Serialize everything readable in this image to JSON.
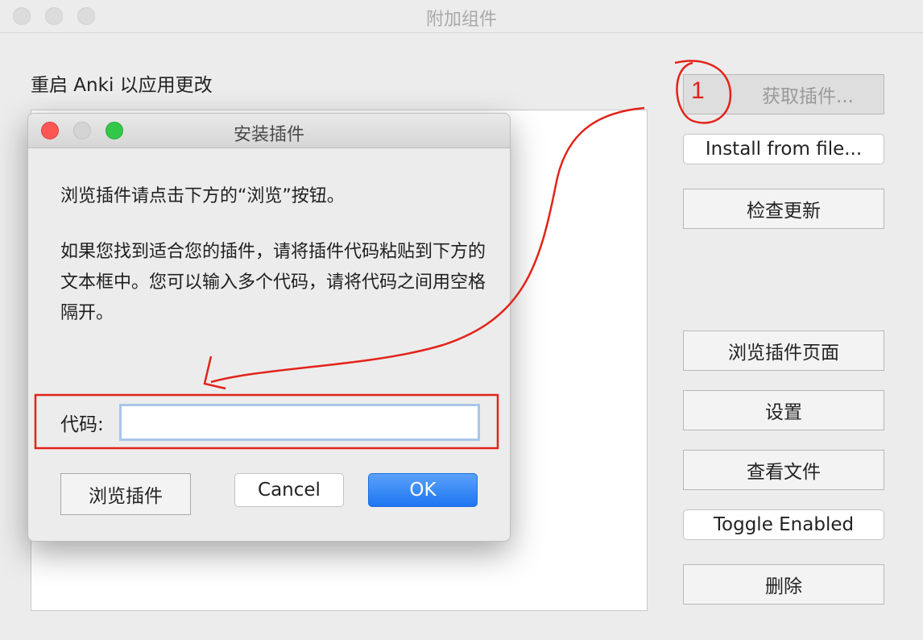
{
  "window": {
    "title": "附加组件"
  },
  "main": {
    "restart_label": "重启 Anki 以应用更改"
  },
  "sidebar": {
    "get_addons": "获取插件...",
    "install_from_file": "Install from file...",
    "check_updates": "检查更新",
    "browse_addons_page": "浏览插件页面",
    "settings": "设置",
    "view_files": "查看文件",
    "toggle_enabled": "Toggle Enabled",
    "delete": "删除"
  },
  "dialog": {
    "title": "安装插件",
    "para1": "浏览插件请点击下方的“浏览”按钮。",
    "para2": "如果您找到适合您的插件，请将插件代码粘贴到下方的文本框中。您可以输入多个代码，请将代码之间用空格隔开。",
    "code_label": "代码:",
    "code_value": "",
    "browse_button": "浏览插件",
    "cancel_button": "Cancel",
    "ok_button": "OK"
  },
  "annotation": {
    "step_number": "1",
    "color": "#e2231a"
  },
  "colors": {
    "ok_blue": "#1e76f1",
    "close_red": "#fc5753",
    "zoom_green": "#33c748"
  }
}
